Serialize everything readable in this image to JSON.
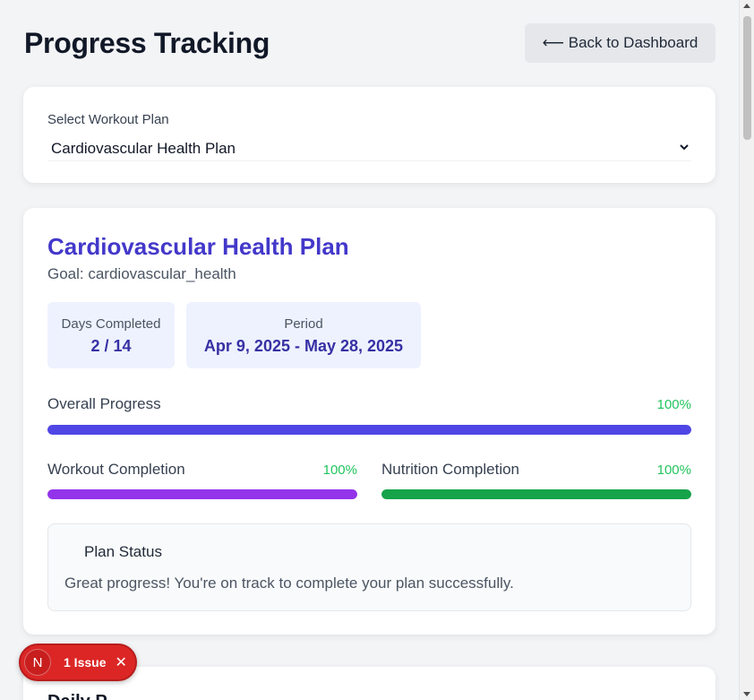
{
  "header": {
    "title": "Progress Tracking",
    "back_label": "⟵ Back to Dashboard"
  },
  "select": {
    "label": "Select Workout Plan",
    "value": "Cardiovascular Health Plan"
  },
  "plan": {
    "title": "Cardiovascular Health Plan",
    "goal": "Goal: cardiovascular_health",
    "days_label": "Days Completed",
    "days_value": "2 / 14",
    "period_label": "Period",
    "period_value": "Apr 9, 2025 - May 28, 2025",
    "overall_label": "Overall Progress",
    "overall_pct": "100%",
    "overall_value": 100,
    "workout_label": "Workout Completion",
    "workout_pct": "100%",
    "workout_value": 100,
    "nutrition_label": "Nutrition Completion",
    "nutrition_pct": "100%",
    "nutrition_value": 100,
    "status_title": "Plan Status",
    "status_text": "Great progress! You're on track to complete your plan successfully."
  },
  "next_section": {
    "title": "Daily P"
  },
  "issue_badge": {
    "logo": "N",
    "label": "1 Issue",
    "close": "✕"
  },
  "colors": {
    "accent": "#4338ca",
    "overall_bar": "#4f46e5",
    "workout_bar": "#9333ea",
    "nutrition_bar": "#16a34a",
    "pct_text": "#22c55e"
  }
}
